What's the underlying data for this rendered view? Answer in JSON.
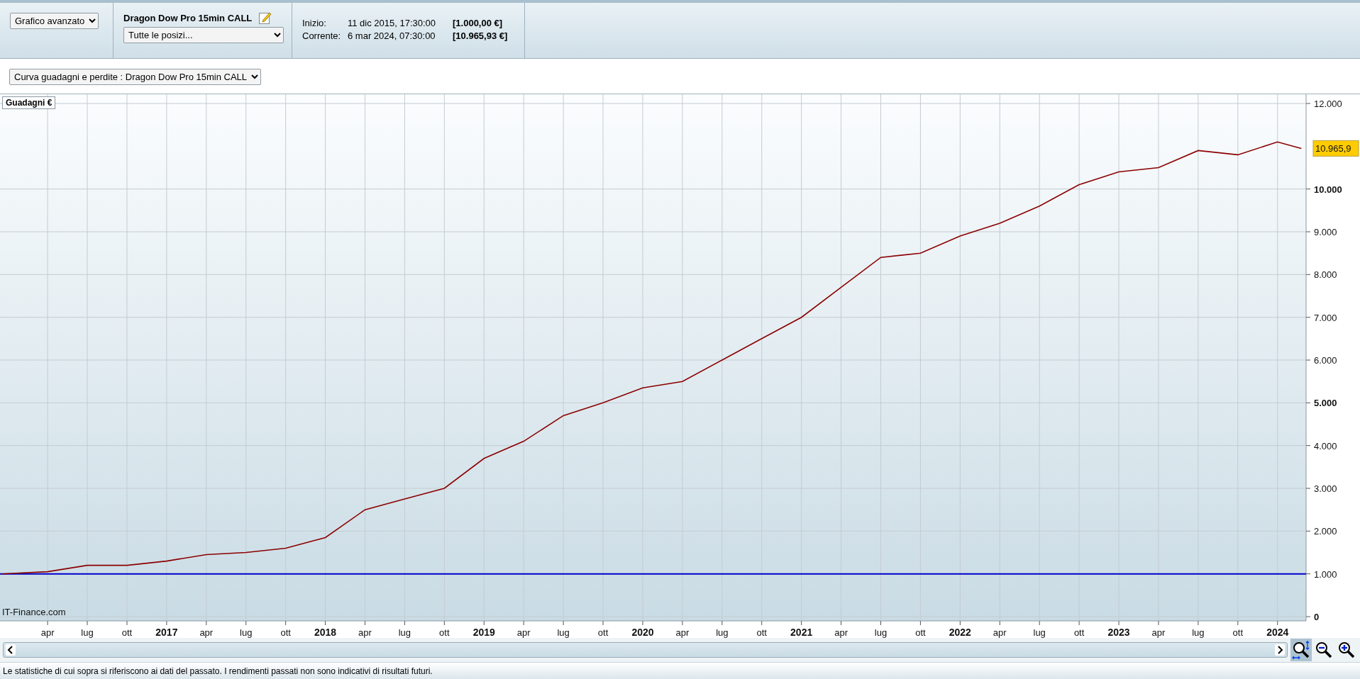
{
  "header": {
    "view_select": "Grafico avanzato",
    "strategy_title": "Dragon Dow Pro 15min CALL",
    "positions_select": "Tutte le posizi...",
    "info_rows": [
      {
        "label": "Inizio:",
        "date": "11 dic 2015, 17:30:00",
        "amount": "[1.000,00 €]"
      },
      {
        "label": "Corrente:",
        "date": "6 mar 2024, 07:30:00",
        "amount": "[10.965,93 €]"
      }
    ]
  },
  "curve_select": "Curva guadagni e perdite : Dragon Dow Pro 15min CALL",
  "chart": {
    "source_label": "IT-Finance.com",
    "current_value_tag": "10.965,9",
    "chart_data": {
      "type": "line",
      "ylabel": "Guadagni €",
      "x": [
        2015.96,
        2016.25,
        2016.5,
        2016.75,
        2017,
        2017.25,
        2017.5,
        2017.75,
        2018,
        2018.25,
        2018.5,
        2018.75,
        2019,
        2019.25,
        2019.5,
        2019.75,
        2020,
        2020.25,
        2020.5,
        2020.75,
        2021,
        2021.25,
        2021.5,
        2021.75,
        2022,
        2022.25,
        2022.5,
        2022.75,
        2023,
        2023.25,
        2023.5,
        2023.75,
        2024,
        2024.15
      ],
      "series": [
        {
          "color": "#8b0000",
          "values": [
            1000,
            1050,
            1200,
            1200,
            1300,
            1450,
            1500,
            1600,
            1850,
            2500,
            2750,
            3000,
            3700,
            4100,
            4700,
            5000,
            5350,
            5500,
            6000,
            6500,
            7000,
            7700,
            8400,
            8500,
            8900,
            9200,
            9600,
            10100,
            10400,
            10500,
            10900,
            10800,
            11100,
            10950
          ]
        }
      ],
      "xlim": [
        2015.95,
        2024.18
      ],
      "grid": true,
      "ylim": [
        0,
        12000
      ],
      "yticks": [
        {
          "value": 0,
          "label": "0"
        },
        {
          "value": 1000,
          "label": "1.000"
        },
        {
          "value": 2000,
          "label": "2.000"
        },
        {
          "value": 3000,
          "label": "3.000"
        },
        {
          "value": 4000,
          "label": "4.000"
        },
        {
          "value": 5000,
          "label": "5.000"
        },
        {
          "value": 6000,
          "label": "6.000"
        },
        {
          "value": 7000,
          "label": "7.000"
        },
        {
          "value": 8000,
          "label": "8.000"
        },
        {
          "value": 9000,
          "label": "9.000"
        },
        {
          "value": 10000,
          "label": "10.000"
        },
        {
          "value": 12000,
          "label": "12.000"
        }
      ],
      "xticks": [
        {
          "value": 2016.25,
          "label": "apr"
        },
        {
          "value": 2016.5,
          "label": "lug"
        },
        {
          "value": 2016.75,
          "label": "ott"
        },
        {
          "value": 2017,
          "label": "2017"
        },
        {
          "value": 2017.25,
          "label": "apr"
        },
        {
          "value": 2017.5,
          "label": "lug"
        },
        {
          "value": 2017.75,
          "label": "ott"
        },
        {
          "value": 2018,
          "label": "2018"
        },
        {
          "value": 2018.25,
          "label": "apr"
        },
        {
          "value": 2018.5,
          "label": "lug"
        },
        {
          "value": 2018.75,
          "label": "ott"
        },
        {
          "value": 2019,
          "label": "2019"
        },
        {
          "value": 2019.25,
          "label": "apr"
        },
        {
          "value": 2019.5,
          "label": "lug"
        },
        {
          "value": 2019.75,
          "label": "ott"
        },
        {
          "value": 2020,
          "label": "2020"
        },
        {
          "value": 2020.25,
          "label": "apr"
        },
        {
          "value": 2020.5,
          "label": "lug"
        },
        {
          "value": 2020.75,
          "label": "ott"
        },
        {
          "value": 2021,
          "label": "2021"
        },
        {
          "value": 2021.25,
          "label": "apr"
        },
        {
          "value": 2021.5,
          "label": "lug"
        },
        {
          "value": 2021.75,
          "label": "ott"
        },
        {
          "value": 2022,
          "label": "2022"
        },
        {
          "value": 2022.25,
          "label": "apr"
        },
        {
          "value": 2022.5,
          "label": "lug"
        },
        {
          "value": 2022.75,
          "label": "ott"
        },
        {
          "value": 2023,
          "label": "2023"
        },
        {
          "value": 2023.25,
          "label": "apr"
        },
        {
          "value": 2023.5,
          "label": "lug"
        },
        {
          "value": 2023.75,
          "label": "ott"
        },
        {
          "value": 2024,
          "label": "2024"
        }
      ],
      "ref_lines": [
        {
          "axis": "y",
          "value": 1000,
          "color": "#0000cc"
        }
      ]
    }
  },
  "zoom_tools": [
    {
      "kind": "fit",
      "selected": true
    },
    {
      "kind": "zoom_out",
      "selected": false
    },
    {
      "kind": "zoom_in",
      "selected": false
    }
  ],
  "disclaimer": "Le statistiche di cui sopra si riferiscono ai dati del passato. I rendimenti passati non sono indicativi di risultati futuri."
}
